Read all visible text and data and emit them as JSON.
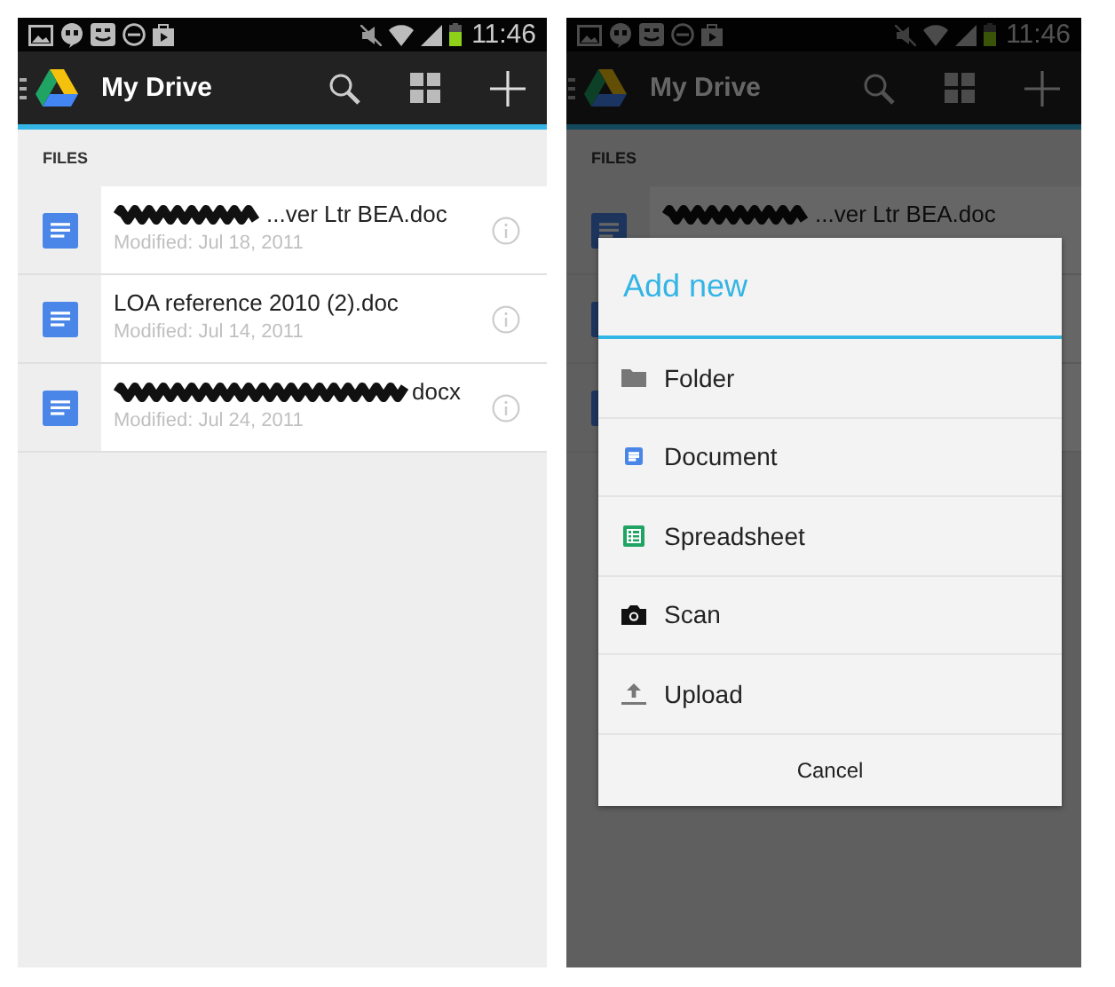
{
  "screens": [
    {
      "status_bar": {
        "time": "11:46"
      },
      "app_bar": {
        "title": "My Drive"
      },
      "section_label": "FILES",
      "dimmed": false,
      "files": [
        {
          "kind": "document",
          "redacted": true,
          "name": "...ver Ltr BEA.doc",
          "modified": "Modified: Jul 18, 2011"
        },
        {
          "kind": "document",
          "redacted": false,
          "name": "LOA reference 2010 (2).doc",
          "modified": "Modified: Jul 14, 2011"
        },
        {
          "kind": "document",
          "redacted": true,
          "name": "docx",
          "modified": "Modified: Jul 24, 2011"
        }
      ]
    },
    {
      "status_bar": {
        "time": "11:46"
      },
      "app_bar": {
        "title": "My Drive"
      },
      "section_label": "FILES",
      "dimmed": true,
      "files": [
        {
          "kind": "document",
          "redacted": true,
          "name": "...ver Ltr BEA.doc"
        },
        {
          "kind": "document"
        },
        {
          "kind": "document"
        }
      ],
      "dialog": {
        "title": "Add new",
        "options": [
          {
            "kind": "folder",
            "label": "Folder"
          },
          {
            "kind": "document",
            "label": "Document"
          },
          {
            "kind": "spreadsheet",
            "label": "Spreadsheet"
          },
          {
            "kind": "camera",
            "label": "Scan"
          },
          {
            "kind": "upload",
            "label": "Upload"
          }
        ],
        "cancel": "Cancel"
      }
    }
  ]
}
